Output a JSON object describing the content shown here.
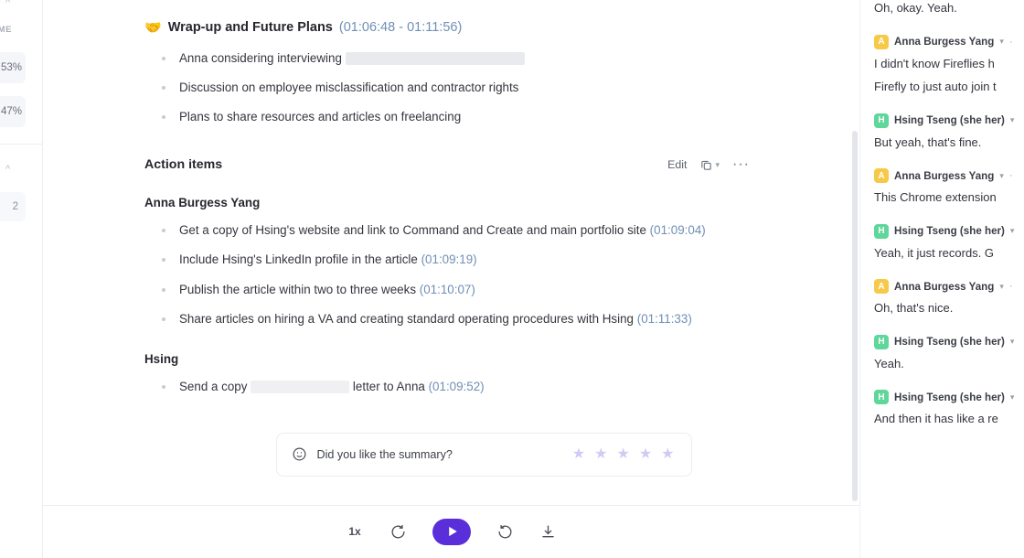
{
  "sidebar": {
    "collapse_top_icon": "chevron-up",
    "time_label": "TIME",
    "stat_1": "53%",
    "stat_2": "47%",
    "collapse_second_icon": "chevron-up",
    "count_badge": "2"
  },
  "summary": {
    "section_emoji": "🤝",
    "section_title": "Wrap-up and Future Plans",
    "time_open": "(",
    "time_start": "01:06:48",
    "time_dash": " - ",
    "time_end": "01:11:56",
    "time_close": ")",
    "bullets": [
      {
        "text": "Anna considering interviewing",
        "redacted": true
      },
      {
        "text": "Discussion on employee misclassification and contractor rights",
        "redacted": false
      },
      {
        "text": "Plans to share resources and articles on freelancing",
        "redacted": false
      }
    ]
  },
  "action_items": {
    "title": "Action items",
    "edit_label": "Edit",
    "copy_icon": "copy-icon",
    "chevron_icon": "chevron-down-icon",
    "more_icon": "more-horizontal-icon",
    "groups": [
      {
        "owner": "Anna Burgess Yang",
        "items": [
          {
            "text": "Get a copy of Hsing's website and link to Command and Create and main portfolio site",
            "time": "01:09:04"
          },
          {
            "text": "Include Hsing's LinkedIn profile in the article",
            "time": "01:09:19"
          },
          {
            "text": "Publish the article within two to three weeks",
            "time": "01:10:07"
          },
          {
            "text": "Share articles on hiring a VA and creating standard operating procedures with Hsing",
            "time": "01:11:33"
          }
        ]
      },
      {
        "owner": "Hsing",
        "items": [
          {
            "text_before": "Send a copy",
            "redacted": true,
            "text_after": "letter to Anna",
            "time": "01:09:52"
          }
        ]
      }
    ]
  },
  "feedback": {
    "icon": "smiley-icon",
    "question": "Did you like the summary?",
    "stars": [
      "★",
      "★",
      "★",
      "★",
      "★"
    ],
    "star_color": "#cfcbf3"
  },
  "player": {
    "speed_label": "1x",
    "rewind_icon": "rewind-15-icon",
    "play_icon": "play-icon",
    "forward_icon": "forward-15-icon",
    "download_icon": "download-icon",
    "accent_color": "#5a2fd9"
  },
  "transcript": {
    "orphan_line": "Oh, okay. Yeah.",
    "messages": [
      {
        "initial": "A",
        "avatar_color": "#f7c948",
        "speaker": "Anna Burgess Yang",
        "chevron": "⌄",
        "dots": "·",
        "lines": [
          "I didn't know Fireflies h",
          "Firefly to just auto join t"
        ]
      },
      {
        "initial": "H",
        "avatar_color": "#5fd69a",
        "speaker": "Hsing Tseng (she her)",
        "chevron": "⌄",
        "dots": "",
        "lines": [
          "But yeah, that's fine."
        ]
      },
      {
        "initial": "A",
        "avatar_color": "#f7c948",
        "speaker": "Anna Burgess Yang",
        "chevron": "⌄",
        "dots": "·",
        "lines": [
          "This Chrome extension"
        ]
      },
      {
        "initial": "H",
        "avatar_color": "#5fd69a",
        "speaker": "Hsing Tseng (she her)",
        "chevron": "⌄",
        "dots": "",
        "lines": [
          "Yeah, it just records. G"
        ]
      },
      {
        "initial": "A",
        "avatar_color": "#f7c948",
        "speaker": "Anna Burgess Yang",
        "chevron": "⌄",
        "dots": "·",
        "lines": [
          "Oh, that's nice."
        ]
      },
      {
        "initial": "H",
        "avatar_color": "#5fd69a",
        "speaker": "Hsing Tseng (she her)",
        "chevron": "⌄",
        "dots": "",
        "lines": [
          "Yeah."
        ]
      },
      {
        "initial": "H",
        "avatar_color": "#5fd69a",
        "speaker": "Hsing Tseng (she her)",
        "chevron": "⌄",
        "dots": "",
        "lines": [
          "And then it has like a re"
        ]
      }
    ]
  }
}
